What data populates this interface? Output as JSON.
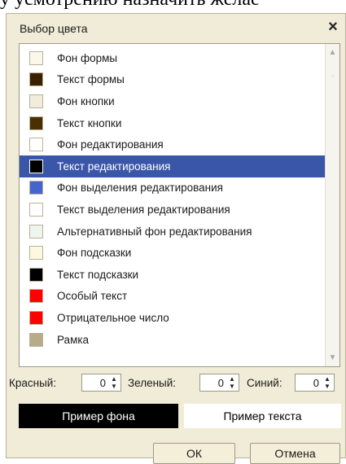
{
  "background_text": "у усмотрению назначить желае",
  "dialog": {
    "title": "Выбор цвета",
    "close_glyph": "×"
  },
  "list": {
    "items": [
      {
        "label": "Фон формы",
        "color": "#fbf7ea",
        "selected": false
      },
      {
        "label": "Текст формы",
        "color": "#3b2000",
        "selected": false
      },
      {
        "label": "Фон кнопки",
        "color": "#f2ecdc",
        "selected": false
      },
      {
        "label": "Текст кнопки",
        "color": "#4a3000",
        "selected": false
      },
      {
        "label": "Фон редактирования",
        "color": "#ffffff",
        "selected": false
      },
      {
        "label": "Текст редактирования",
        "color": "#000000",
        "selected": true
      },
      {
        "label": "Фон выделения редактирования",
        "color": "#4466cc",
        "selected": false
      },
      {
        "label": "Текст выделения редактирования",
        "color": "#ffffff",
        "selected": false
      },
      {
        "label": "Альтернативный фон редактирования",
        "color": "#eef4ee",
        "selected": false
      },
      {
        "label": "Фон подсказки",
        "color": "#fdf8e0",
        "selected": false
      },
      {
        "label": "Текст подсказки",
        "color": "#000000",
        "selected": false
      },
      {
        "label": "Особый текст",
        "color": "#ff0000",
        "selected": false
      },
      {
        "label": "Отрицательное число",
        "color": "#ff0000",
        "selected": false
      },
      {
        "label": "Рамка",
        "color": "#b8ab8a",
        "selected": false
      }
    ],
    "scroll_up_glyph": "▲",
    "scroll_down_glyph": "▼"
  },
  "rgb": {
    "red_label": "Красный:",
    "red_value": "0",
    "green_label": "Зеленый:",
    "green_value": "0",
    "blue_label": "Синий:",
    "blue_value": "0"
  },
  "samples": {
    "background_label": "Пример фона",
    "text_label": "Пример текста"
  },
  "buttons": {
    "ok": "ОК",
    "cancel": "Отмена"
  }
}
